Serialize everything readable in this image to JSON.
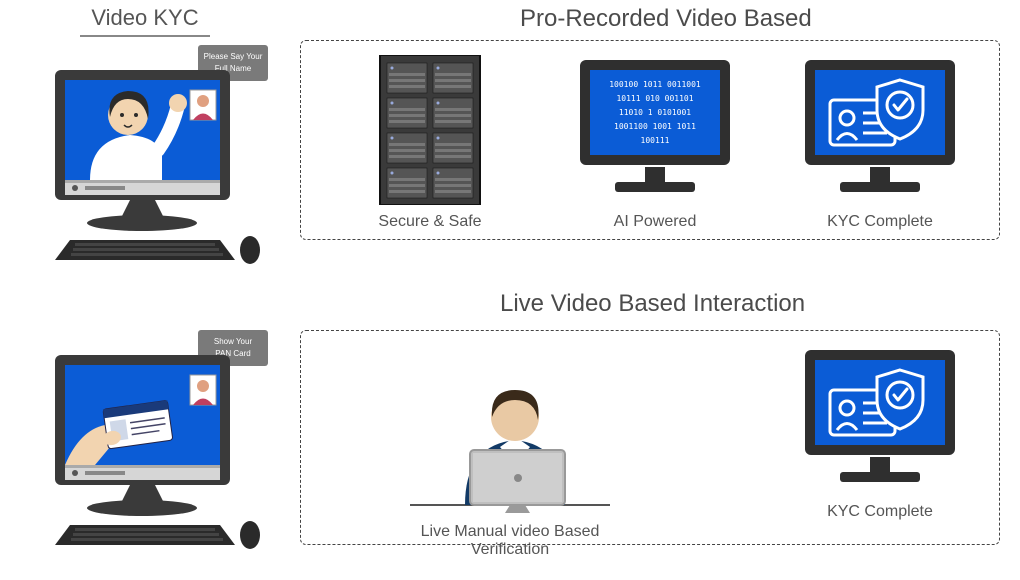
{
  "left_title": "Video KYC",
  "section1": {
    "title": "Pro-Recorded Video Based",
    "items": [
      {
        "label": "Secure & Safe"
      },
      {
        "label": "AI Powered"
      },
      {
        "label": "KYC Complete"
      }
    ]
  },
  "section2": {
    "title": "Live Video Based Interaction",
    "items": [
      {
        "label": "Live Manual video Based Verification"
      },
      {
        "label": "KYC Complete"
      }
    ]
  },
  "illustration1": {
    "speech": "Please Say Your Full Name"
  },
  "illustration2": {
    "speech": "Show Your PAN Card"
  },
  "ai_text": "100100 1011  0011001\n10111 010  001101\n11010 1    0101001\n1001100 1001  1011\n   100111",
  "colors": {
    "accent_blue": "#0b5cd6",
    "monitor_dark": "#2f2f2f",
    "box_gray": "#555555"
  }
}
